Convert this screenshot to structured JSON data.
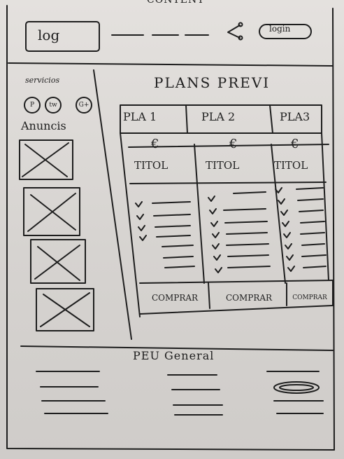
{
  "top_scribble": "CONTENT",
  "header": {
    "logo_label": "log",
    "login_label": "login"
  },
  "sidebar": {
    "services_title": "servicios",
    "social_icons": [
      {
        "icon": "p-icon",
        "glyph": "P"
      },
      {
        "icon": "tw-icon",
        "glyph": "tw"
      },
      {
        "icon": "gplus-icon",
        "glyph": "G+"
      }
    ],
    "ads_title": "Anuncis",
    "ads_count": 4
  },
  "plans": {
    "title": "PLANS PREVI",
    "items": [
      {
        "name": "PLA 1",
        "price": "€",
        "subtitle": "TITOL",
        "features": 4,
        "buy_label": "COMPRAR"
      },
      {
        "name": "PLA 2",
        "price": "€",
        "subtitle": "TITOL",
        "features": 7,
        "buy_label": "COMPRAR"
      },
      {
        "name": "PLA3",
        "price": "€",
        "subtitle": "TITOL",
        "features": 8,
        "buy_label": "COMPRAR"
      }
    ]
  },
  "footer": {
    "title": "PEU General"
  }
}
